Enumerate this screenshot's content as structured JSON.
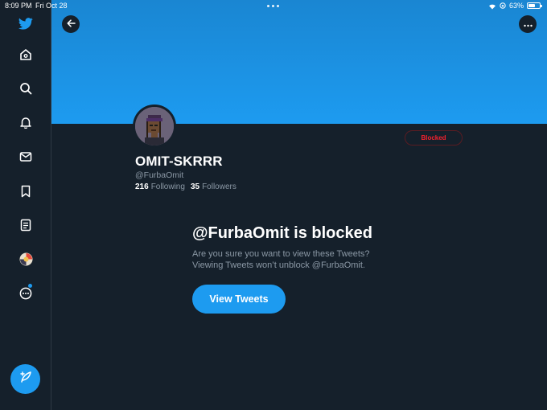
{
  "status_bar": {
    "time": "8:09 PM",
    "date": "Fri Oct 28",
    "battery": "63%",
    "battery_level": 0.63
  },
  "sidebar": {
    "items": [
      {
        "icon": "twitter-logo-icon"
      },
      {
        "icon": "home-icon"
      },
      {
        "icon": "search-icon"
      },
      {
        "icon": "bell-icon"
      },
      {
        "icon": "mail-icon"
      },
      {
        "icon": "bookmark-icon"
      },
      {
        "icon": "list-icon"
      },
      {
        "icon": "account-avatar-icon"
      },
      {
        "icon": "more-circle-icon"
      }
    ],
    "compose_icon": "compose-feather-icon"
  },
  "header": {
    "back_icon": "back-arrow-icon",
    "more_icon": "more-dots-icon",
    "banner_color": "#1d9bf0"
  },
  "profile": {
    "display_name": "OMIT-SKRRR",
    "handle": "@FurbaOmit",
    "following_count": "216",
    "following_label": "Following",
    "followers_count": "35",
    "followers_label": "Followers",
    "blocked_button": "Blocked"
  },
  "blocked_notice": {
    "title": "@FurbaOmit is blocked",
    "line1": "Are you sure you want to view these Tweets?",
    "line2": "Viewing Tweets won’t unblock @FurbaOmit.",
    "view_button": "View Tweets"
  },
  "colors": {
    "background": "#15202b",
    "accent": "#1d9bf0",
    "danger": "#f4212e",
    "secondary_text": "#8b98a5"
  }
}
